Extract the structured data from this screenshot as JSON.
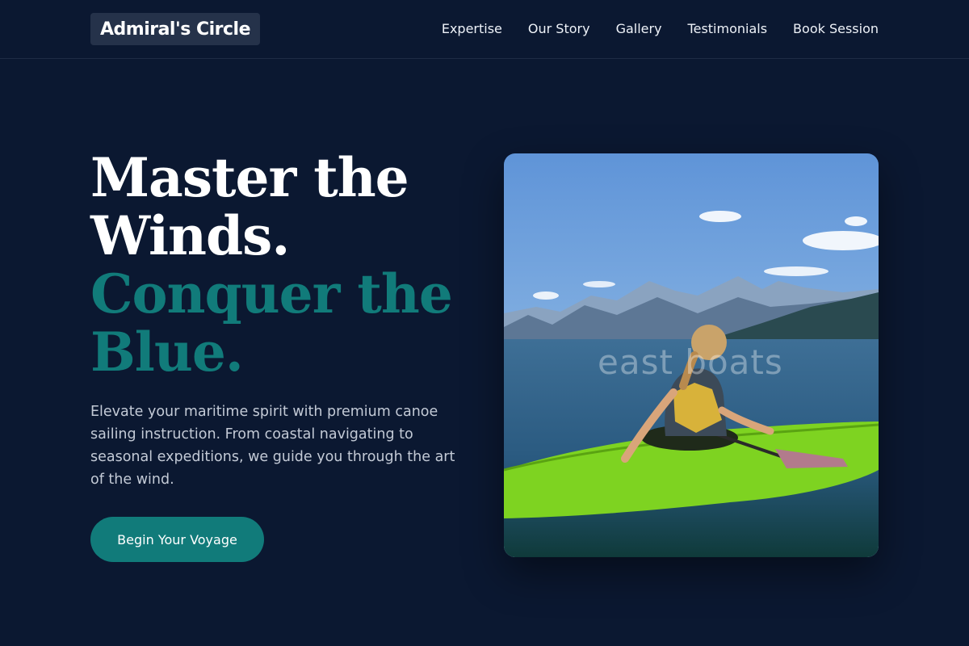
{
  "brand": {
    "name": "Admiral's Circle"
  },
  "nav": {
    "links": [
      "Expertise",
      "Our Story",
      "Gallery",
      "Testimonials",
      "Book Session"
    ]
  },
  "hero": {
    "headline_line1": "Master the",
    "headline_line2": "Winds.",
    "headline_line3": "Conquer the",
    "headline_line4": "Blue.",
    "description": "Elevate your maritime spirit with premium canoe sailing instruction. From coastal navigating to seasonal expeditions, we guide you through the art of the wind.",
    "cta_label": "Begin Your Voyage"
  },
  "image": {
    "watermark": "east boats",
    "subject": "kayaker-on-mountain-lake"
  },
  "colors": {
    "background": "#0b1831",
    "accent": "#117b7a",
    "brand_box": "#25324a",
    "kayak_green": "#7ed321"
  }
}
